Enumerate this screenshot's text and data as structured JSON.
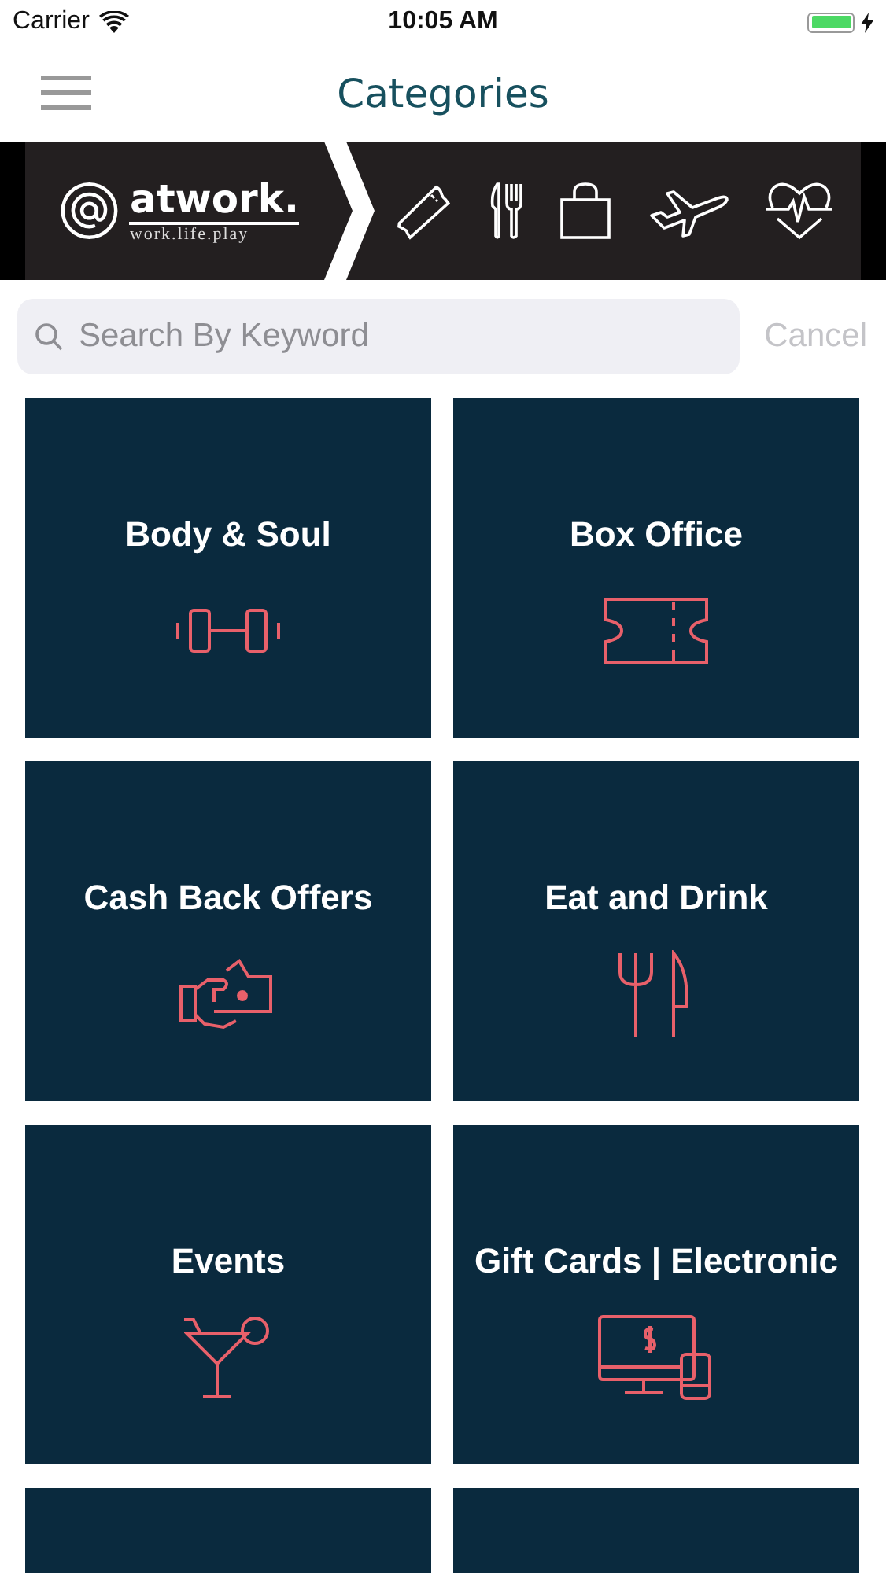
{
  "status_bar": {
    "carrier": "Carrier",
    "time": "10:05 AM"
  },
  "nav": {
    "title": "Categories"
  },
  "banner": {
    "brand": "atwork.",
    "tagline": "work.life.play"
  },
  "search": {
    "placeholder": "Search By Keyword",
    "cancel": "Cancel"
  },
  "categories": [
    {
      "title": "Body & Soul"
    },
    {
      "title": "Box Office"
    },
    {
      "title": "Cash Back Offers"
    },
    {
      "title": "Eat and Drink"
    },
    {
      "title": "Events"
    },
    {
      "title": "Gift Cards | Electronic"
    }
  ]
}
